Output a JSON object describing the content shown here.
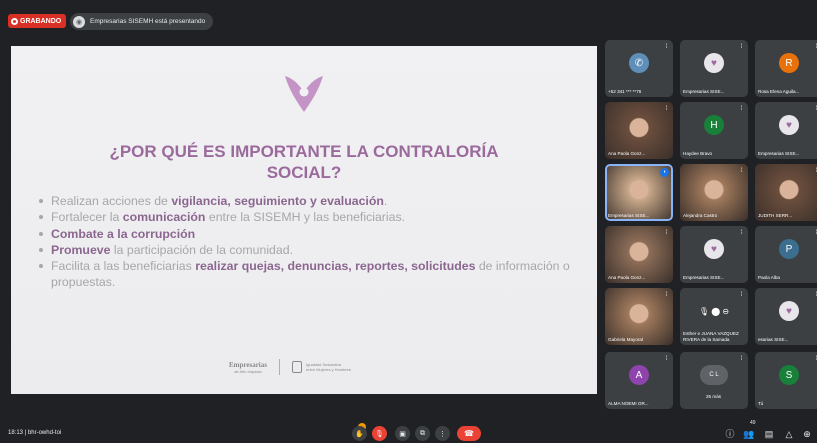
{
  "top_bar": {
    "recording_label": "GRABANDO",
    "presenter_text": "Empresarias SISEMH está presentando"
  },
  "slide": {
    "title": "¿POR QUÉ ES IMPORTANTE LA CONTRALORÍA SOCIAL?",
    "bullets": [
      {
        "parts": [
          "Realizan acciones de ",
          "vigilancia, seguimiento y evaluación",
          "."
        ]
      },
      {
        "parts": [
          "Fortalecer la ",
          "comunicación",
          " entre la SISEMH y las beneficiarias."
        ]
      },
      {
        "parts": [
          "",
          "Combate a la corrupción",
          ""
        ]
      },
      {
        "parts": [
          "",
          "Promueve",
          " la participación de la comunidad."
        ]
      },
      {
        "parts": [
          "Facilita a las beneficiarias ",
          "realizar quejas, denuncias, reportes, solicitudes",
          " de información o propuestas."
        ]
      }
    ],
    "logo_left_line1": "Empresarias",
    "logo_left_line2": "de Alto Impacto",
    "logo_right_line1": "Igualdad Sustantiva",
    "logo_right_line2": "entre Mujeres y Hombres",
    "accent_color": "#9b6a9d"
  },
  "participants": [
    {
      "name": "+52 341 *** **76",
      "kind": "icon",
      "avatar": "phone-icon",
      "color": "#5f8fb8"
    },
    {
      "name": "Empresarias SISE...",
      "kind": "logo"
    },
    {
      "name": "Rosa Elena Aguila...",
      "kind": "letter",
      "avatar": "R",
      "color": "#e8710a"
    },
    {
      "name": "Ana Paola Gonz...",
      "kind": "photo"
    },
    {
      "name": "Haydee Bravo",
      "kind": "letter",
      "avatar": "H",
      "color": "#188038"
    },
    {
      "name": "Empresarias SISE...",
      "kind": "logo"
    },
    {
      "name": "Empresarias SISE...",
      "kind": "photo"
    },
    {
      "name": "Alejandra Castro",
      "kind": "photo"
    },
    {
      "name": "JUDITH SERR...",
      "kind": "photo"
    },
    {
      "name": "Ana Paola Gonz...",
      "kind": "photo"
    },
    {
      "name": "Empresarias SISE...",
      "kind": "logo"
    },
    {
      "name": "Paola Alba",
      "kind": "letter",
      "avatar": "P",
      "color": "#3c6e8f"
    },
    {
      "name": "Gabriela Mayoral",
      "kind": "photo"
    },
    {
      "name": "Esther e JUANA VAZQUEZ RIVERA de la Samada",
      "kind": "group"
    },
    {
      "name": "esarias SISE...",
      "kind": "logo"
    },
    {
      "name": "ALMA NOEMI OR...",
      "kind": "letter",
      "avatar": "A",
      "color": "#8e44ad"
    },
    {
      "name": "25 más",
      "kind": "more"
    },
    {
      "name": "Tú",
      "kind": "letter",
      "avatar": "S",
      "color": "#188038"
    }
  ],
  "bottom_bar": {
    "meeting_info": "18:13 | bhr-owhd-toi",
    "people_count": "49"
  }
}
